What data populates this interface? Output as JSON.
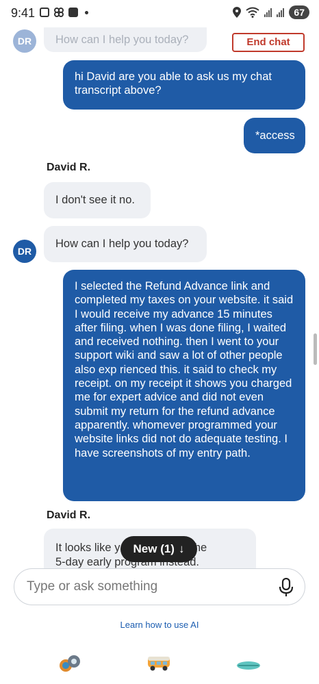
{
  "status_bar": {
    "time": "9:41",
    "battery": "67"
  },
  "header": {
    "end_chat_label": "End chat"
  },
  "messages": {
    "agent_initials": "DR",
    "faded_greeting": "How can I help you today?",
    "user_1": "hi David are you able to ask us my chat transcript above?",
    "user_2": "*access",
    "sender_1": "David R.",
    "agent_1": "I don't see it no.",
    "agent_2": "How can I help you today?",
    "user_3": "I selected the Refund Advance link and completed my taxes on your website. it said I would receive my advance 15 minutes after filing. when I was done filing, I waited and received nothing. then I went to your support wiki and saw a lot of other people also exp rienced this. it said to check my receipt. on my receipt it shows you charged me for expert advice and did not even submit my return for the refund advance apparently. whomever programmed your website links did not do adequate testing. I have screenshots of my entry path.",
    "sender_2": "David R.",
    "agent_3_line1": "It looks like y",
    "agent_3_line1_end": "for the",
    "agent_3_line2": "5-day early program instead."
  },
  "new_pill": {
    "label": "New (1)",
    "arrow": "↓"
  },
  "composer": {
    "placeholder": "Type or ask something"
  },
  "footer": {
    "learn_link": "Learn how to use AI"
  },
  "colors": {
    "accent": "#1f5ba6",
    "danger": "#c0392b",
    "bubble_in": "#eef0f4"
  },
  "nav_icons": [
    "assist-icon",
    "van-icon",
    "surfboard-icon"
  ]
}
